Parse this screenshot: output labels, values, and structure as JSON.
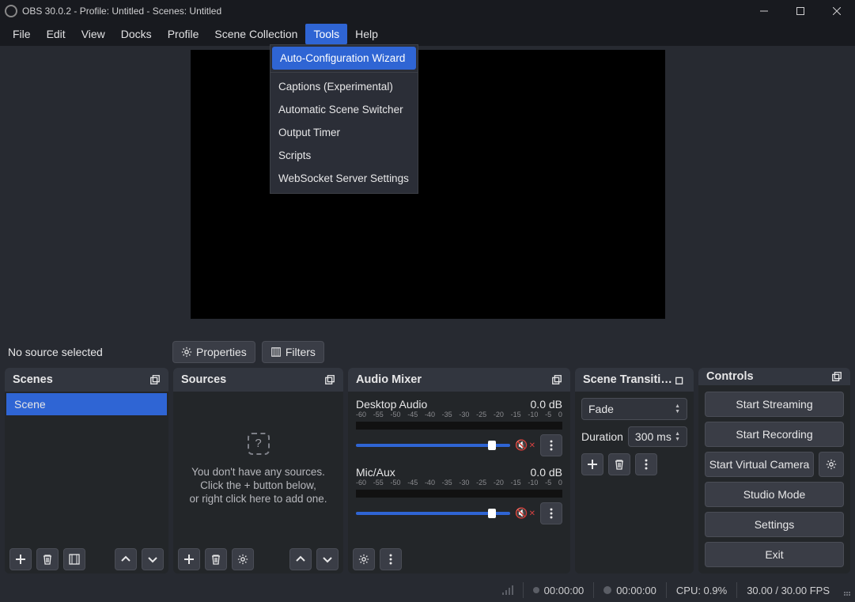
{
  "title": "OBS 30.0.2 - Profile: Untitled - Scenes: Untitled",
  "menus": {
    "file": "File",
    "edit": "Edit",
    "view": "View",
    "docks": "Docks",
    "profile": "Profile",
    "scene_collection": "Scene Collection",
    "tools": "Tools",
    "help": "Help"
  },
  "tools_dropdown": {
    "auto_config": "Auto-Configuration Wizard",
    "captions": "Captions (Experimental)",
    "scene_switcher": "Automatic Scene Switcher",
    "output_timer": "Output Timer",
    "scripts": "Scripts",
    "websocket": "WebSocket Server Settings"
  },
  "toolbar": {
    "no_source": "No source selected",
    "properties": "Properties",
    "filters": "Filters"
  },
  "panels": {
    "scenes": "Scenes",
    "sources": "Sources",
    "mixer": "Audio Mixer",
    "transitions": "Scene Transiti…",
    "controls": "Controls"
  },
  "scenes": {
    "items": [
      {
        "label": "Scene"
      }
    ]
  },
  "sources_empty": {
    "line1": "You don't have any sources.",
    "line2": "Click the + button below,",
    "line3": "or right click here to add one."
  },
  "mixer": {
    "ticks": [
      "-60",
      "-55",
      "-50",
      "-45",
      "-40",
      "-35",
      "-30",
      "-25",
      "-20",
      "-15",
      "-10",
      "-5",
      "0"
    ],
    "channels": [
      {
        "name": "Desktop Audio",
        "level": "0.0 dB"
      },
      {
        "name": "Mic/Aux",
        "level": "0.0 dB"
      }
    ]
  },
  "transitions": {
    "selected": "Fade",
    "duration_label": "Duration",
    "duration": "300 ms"
  },
  "controls": {
    "stream": "Start Streaming",
    "record": "Start Recording",
    "vcam": "Start Virtual Camera",
    "studio": "Studio Mode",
    "settings": "Settings",
    "exit": "Exit"
  },
  "status": {
    "live_time": "00:00:00",
    "rec_time": "00:00:00",
    "cpu": "CPU: 0.9%",
    "fps": "30.00 / 30.00 FPS"
  }
}
